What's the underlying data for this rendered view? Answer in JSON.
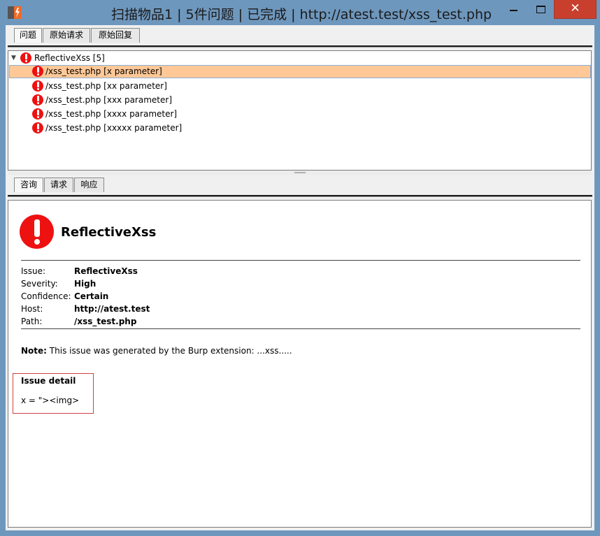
{
  "window": {
    "title": "扫描物品1 | 5件问题 | 已完成 | http://atest.test/xss_test.php",
    "close_glyph": "✕"
  },
  "top_tabs": [
    {
      "label": "问题",
      "active": true
    },
    {
      "label": "原始请求",
      "active": false
    },
    {
      "label": "原始回复",
      "active": false
    }
  ],
  "tree": {
    "root_label": "ReflectiveXss [5]",
    "items": [
      {
        "label": "/xss_test.php [x parameter]",
        "selected": true
      },
      {
        "label": "/xss_test.php [xx parameter]",
        "selected": false
      },
      {
        "label": "/xss_test.php [xxx parameter]",
        "selected": false
      },
      {
        "label": "/xss_test.php [xxxx parameter]",
        "selected": false
      },
      {
        "label": "/xss_test.php [xxxxx parameter]",
        "selected": false
      }
    ]
  },
  "bottom_tabs": [
    {
      "label": "咨询",
      "active": true
    },
    {
      "label": "请求",
      "active": false
    },
    {
      "label": "响应",
      "active": false
    }
  ],
  "advisory": {
    "heading": "ReflectiveXss",
    "fields": [
      {
        "key": "Issue:",
        "value": "ReflectiveXss"
      },
      {
        "key": "Severity:",
        "value": "High"
      },
      {
        "key": "Confidence:",
        "value": "Certain"
      },
      {
        "key": "Host:",
        "value": "http://atest.test"
      },
      {
        "key": "Path:",
        "value": "/xss_test.php"
      }
    ],
    "note_label": "Note:",
    "note_text": "This issue was generated by the Burp extension: ...xss.....",
    "detail_title": "Issue detail",
    "detail_body": "x = \"><img>"
  },
  "colors": {
    "titlebar": "#6e97bd",
    "close_button": "#c8402d",
    "selected_row": "#ffc896",
    "error_icon": "#ee1111",
    "detail_box_border": "#d04040"
  }
}
